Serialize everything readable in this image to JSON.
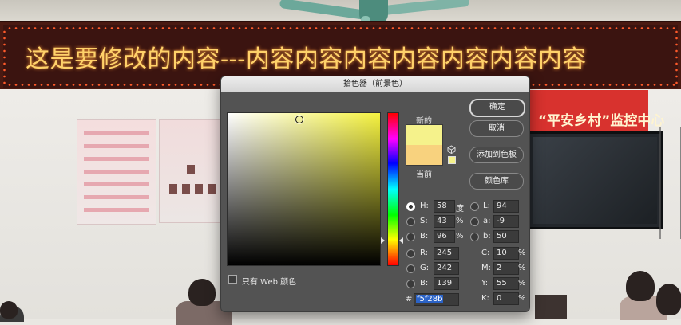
{
  "background": {
    "led_text": "这是要修改的内容---内容内容内容内容内容内容内容",
    "banner_text": "“平安乡村”监控中心"
  },
  "dialog": {
    "title": "拾色器（前景色）",
    "new_label": "新的",
    "current_label": "当前",
    "new_color": "#f5f28b",
    "current_color": "#f8d27e",
    "buttons": {
      "ok": "确定",
      "cancel": "取消",
      "add_to_swatches": "添加到色板",
      "color_libraries": "颜色库"
    },
    "web_colors_only": "只有 Web 颜色",
    "hsb": {
      "h_label": "H:",
      "h_value": "58",
      "h_unit": "度",
      "s_label": "S:",
      "s_value": "43",
      "s_unit": "%",
      "b_label": "B:",
      "b_value": "96",
      "b_unit": "%"
    },
    "rgb": {
      "r_label": "R:",
      "r_value": "245",
      "g_label": "G:",
      "g_value": "242",
      "b_label": "B:",
      "b_value": "139"
    },
    "lab": {
      "l_label": "L:",
      "l_value": "94",
      "a_label": "a:",
      "a_value": "-9",
      "b_label": "b:",
      "b_value": "50"
    },
    "cmyk": {
      "c_label": "C:",
      "c_value": "10",
      "m_label": "M:",
      "m_value": "2",
      "y_label": "Y:",
      "y_value": "55",
      "k_label": "K:",
      "k_value": "0",
      "unit": "%"
    },
    "hex_label": "#",
    "hex_value": "f5f28b",
    "selected_mode": "H"
  }
}
